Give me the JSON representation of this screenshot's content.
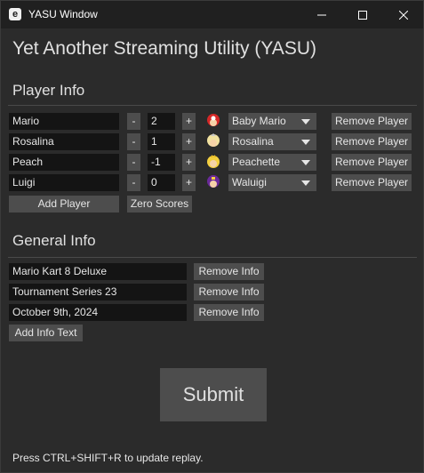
{
  "window": {
    "app_icon_letter": "e",
    "title": "YASU Window"
  },
  "app_title": "Yet Another Streaming Utility (YASU)",
  "player_info": {
    "heading": "Player Info",
    "players": [
      {
        "name": "Mario",
        "score": "2",
        "character": "Baby Mario",
        "icon": "baby-mario-icon",
        "icon_color": "#d62828"
      },
      {
        "name": "Rosalina",
        "score": "1",
        "character": "Rosalina",
        "icon": "rosalina-icon",
        "icon_color": "#f2e2a0"
      },
      {
        "name": "Peach",
        "score": "-1",
        "character": "Peachette",
        "icon": "peachette-icon",
        "icon_color": "#f4d03f"
      },
      {
        "name": "Luigi",
        "score": "0",
        "character": "Waluigi",
        "icon": "waluigi-icon",
        "icon_color": "#6a2a9a"
      }
    ],
    "minus_label": "-",
    "plus_label": "+",
    "remove_label": "Remove Player",
    "add_player_label": "Add Player",
    "zero_scores_label": "Zero Scores"
  },
  "general_info": {
    "heading": "General Info",
    "items": [
      {
        "text": "Mario Kart 8 Deluxe"
      },
      {
        "text": "Tournament Series 23"
      },
      {
        "text": "October 9th, 2024"
      }
    ],
    "remove_label": "Remove Info",
    "add_label": "Add Info Text"
  },
  "submit_label": "Submit",
  "footer_note": "Press CTRL+SHIFT+R to update replay."
}
